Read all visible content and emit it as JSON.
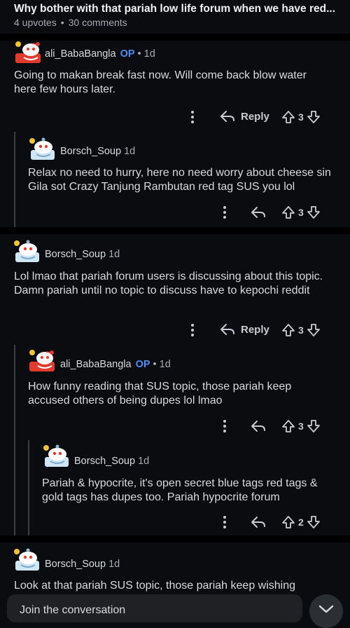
{
  "post": {
    "title": "Why bother with that pariah low life forum when we have red...",
    "upvotes": "4 upvotes",
    "comments": "30 comments"
  },
  "comments": [
    {
      "author": "ali_BabaBangla",
      "op": "OP",
      "meta": "• 1d",
      "body": "Going to makan break fast now. Will come back blow water here few hours later.",
      "reply_label": "Reply",
      "votes": "3",
      "avatar": "red-snoo-avatar"
    },
    {
      "author": "Borsch_Soup",
      "meta": "1d",
      "body": "Relax no need to hurry, here no need worry about cheese sin Gila sot Crazy Tanjung Rambutan red tag SUS you lol",
      "votes": "3",
      "avatar": "white-snoo-avatar"
    },
    {
      "author": "Borsch_Soup",
      "meta": "1d",
      "body": "Lol lmao that pariah forum users is discussing about this topic. Damn pariah until no topic to discuss have to kepochi reddit",
      "reply_label": "Reply",
      "votes": "3",
      "avatar": "white-snoo-avatar"
    },
    {
      "author": "ali_BabaBangla",
      "op": "OP",
      "meta": "• 1d",
      "body": "How funny reading that SUS topic, those pariah keep accused others of being dupes lol lmao",
      "votes": "3",
      "avatar": "red-snoo-avatar"
    },
    {
      "author": "Borsch_Soup",
      "meta": "1d",
      "body": "Pariah & hypocrite, it's open secret blue tags red tags & gold tags has dupes too. Pariah hypocrite forum",
      "votes": "2",
      "avatar": "white-snoo-avatar"
    },
    {
      "author": "Borsch_Soup",
      "meta": "1d",
      "body": "Look at that pariah SUS topic, those pariah keep wishing",
      "avatar": "white-snoo-avatar"
    }
  ],
  "composer": {
    "placeholder": "Join the conversation"
  },
  "colors": {
    "background": "#0b0c0f",
    "op_badge": "#4e8ef7",
    "separator": "#000000",
    "thread_line": "#3a3d42"
  }
}
